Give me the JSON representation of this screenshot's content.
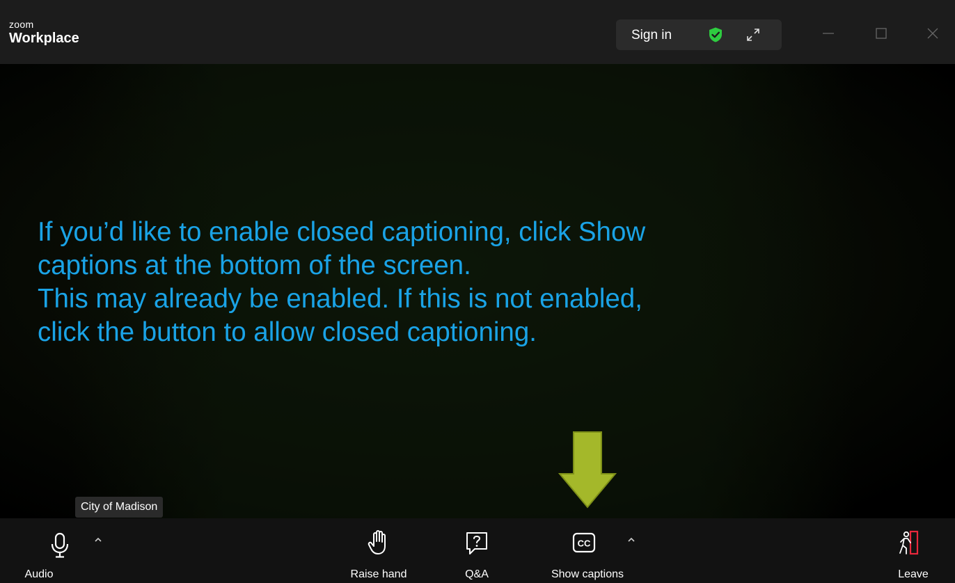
{
  "titlebar": {
    "brand_small": "zoom",
    "brand_big": "Workplace",
    "sign_in_label": "Sign in",
    "icons": [
      "shield-check-icon",
      "expand-icon",
      "minimize-icon",
      "maximize-icon",
      "close-icon"
    ],
    "shield_color": "#2ecc40"
  },
  "video": {
    "instruction_lines": [
      "If you’d like to enable closed captioning, click Show",
      "captions at the bottom of the screen.",
      "This may already be enabled. If this is not enabled,",
      "click the button to allow closed captioning."
    ],
    "instruction_color": "#1aa3e6",
    "arrow_color": "#a4b82a",
    "participant_name": "City of Madison"
  },
  "toolbar": {
    "audio_label": "Audio",
    "raise_hand_label": "Raise hand",
    "qa_label": "Q&A",
    "show_captions_label": "Show captions",
    "leave_label": "Leave",
    "leave_color": "#e8283c"
  }
}
